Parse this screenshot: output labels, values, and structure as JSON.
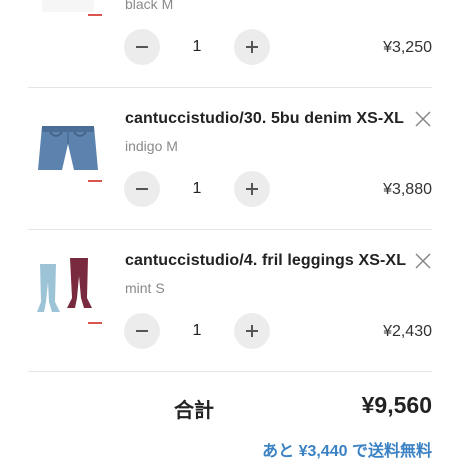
{
  "colors": {
    "accent": "#3b82c4",
    "divider": "#e6e6e6",
    "qty_button_bg": "#ececec",
    "muted_text": "#8a8a8a"
  },
  "cart": {
    "items": [
      {
        "title": "",
        "variant": "black M",
        "quantity": "1",
        "price": "¥3,250",
        "thumbnail": "product-thumbnail"
      },
      {
        "title": "cantuccistudio/30. 5bu denim XS-XL",
        "variant": "indigo M",
        "quantity": "1",
        "price": "¥3,880",
        "thumbnail": "denim-shorts-thumbnail"
      },
      {
        "title": "cantuccistudio/4. fril leggings XS-XL",
        "variant": "mint S",
        "quantity": "1",
        "price": "¥2,430",
        "thumbnail": "leggings-thumbnail"
      }
    ]
  },
  "summary": {
    "total_label": "合計",
    "total_value": "¥9,560",
    "shipping_note": "あと ¥3,440 で送料無料"
  },
  "icons": {
    "minus": "minus-icon",
    "plus": "plus-icon",
    "remove": "close-icon"
  }
}
